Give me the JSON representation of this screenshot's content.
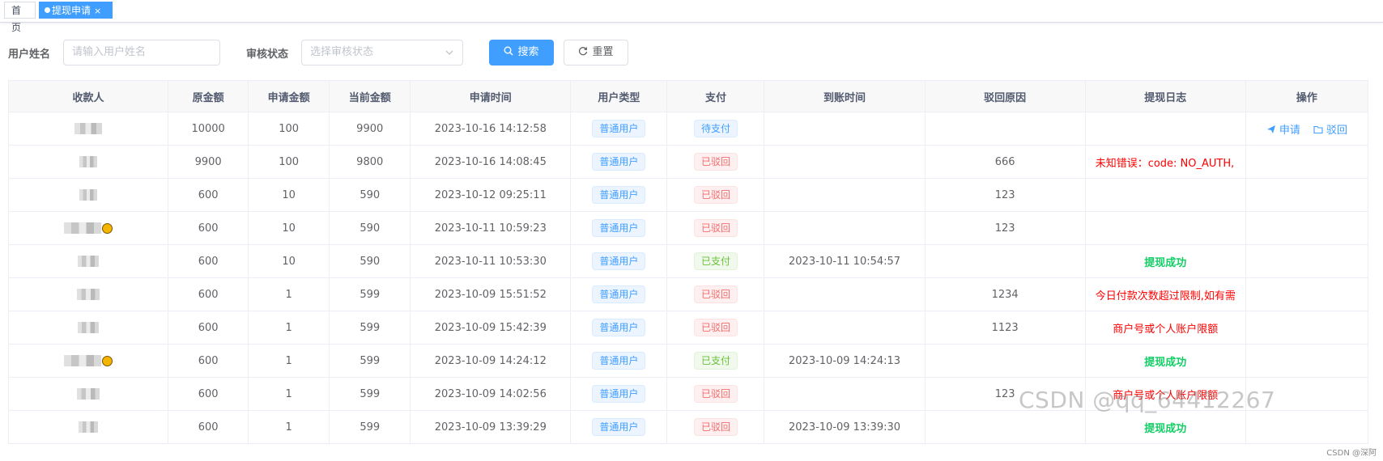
{
  "tags": {
    "home": "首页",
    "active": "提现申请",
    "close": "×"
  },
  "search": {
    "username_label": "用户姓名",
    "username_placeholder": "请输入用户姓名",
    "status_label": "审核状态",
    "status_placeholder": "选择审核状态",
    "search_button": "搜索",
    "reset_button": "重置"
  },
  "table": {
    "headers": [
      "收款人",
      "原金额",
      "申请金额",
      "当前金额",
      "申请时间",
      "用户类型",
      "支付",
      "到账时间",
      "驳回原因",
      "提现日志",
      "操作"
    ],
    "rows": [
      {
        "orig": "10000",
        "apply": "100",
        "current": "9900",
        "time": "2023-10-16 14:12:58",
        "user_type": "普通用户",
        "pay": "待支付",
        "arrive": "",
        "reject": "",
        "log": "",
        "op_apply": "申请",
        "op_reject": "驳回"
      },
      {
        "orig": "9900",
        "apply": "100",
        "current": "9800",
        "time": "2023-10-16 14:08:45",
        "user_type": "普通用户",
        "pay": "已驳回",
        "arrive": "",
        "reject": "666",
        "log": "未知错误：code: NO_AUTH,"
      },
      {
        "orig": "600",
        "apply": "10",
        "current": "590",
        "time": "2023-10-12 09:25:11",
        "user_type": "普通用户",
        "pay": "已驳回",
        "arrive": "",
        "reject": "123",
        "log": ""
      },
      {
        "orig": "600",
        "apply": "10",
        "current": "590",
        "time": "2023-10-11 10:59:23",
        "user_type": "普通用户",
        "pay": "已驳回",
        "arrive": "",
        "reject": "123",
        "log": ""
      },
      {
        "orig": "600",
        "apply": "10",
        "current": "590",
        "time": "2023-10-11 10:53:30",
        "user_type": "普通用户",
        "pay": "已支付",
        "arrive": "2023-10-11 10:54:57",
        "reject": "",
        "log": "提现成功"
      },
      {
        "orig": "600",
        "apply": "1",
        "current": "599",
        "time": "2023-10-09 15:51:52",
        "user_type": "普通用户",
        "pay": "已驳回",
        "arrive": "",
        "reject": "1234",
        "log": "今日付款次数超过限制,如有需"
      },
      {
        "orig": "600",
        "apply": "1",
        "current": "599",
        "time": "2023-10-09 15:42:39",
        "user_type": "普通用户",
        "pay": "已驳回",
        "arrive": "",
        "reject": "1123",
        "log": "商户号或个人账户限额"
      },
      {
        "orig": "600",
        "apply": "1",
        "current": "599",
        "time": "2023-10-09 14:24:12",
        "user_type": "普通用户",
        "pay": "已支付",
        "arrive": "2023-10-09 14:24:13",
        "reject": "",
        "log": "提现成功"
      },
      {
        "orig": "600",
        "apply": "1",
        "current": "599",
        "time": "2023-10-09 14:02:56",
        "user_type": "普通用户",
        "pay": "已驳回",
        "arrive": "",
        "reject": "123",
        "log": "商户号或个人账户限额"
      },
      {
        "orig": "600",
        "apply": "1",
        "current": "599",
        "time": "2023-10-09 13:39:29",
        "user_type": "普通用户",
        "pay": "已驳回",
        "arrive": "2023-10-09 13:39:30",
        "reject": "",
        "log": "提现成功"
      }
    ]
  },
  "watermark": {
    "main": "CSDN @qq_64412267",
    "small": "CSDN @深阿"
  },
  "colors": {
    "primary": "#409eff",
    "danger": "#f56c6c",
    "success": "#67c23a"
  }
}
